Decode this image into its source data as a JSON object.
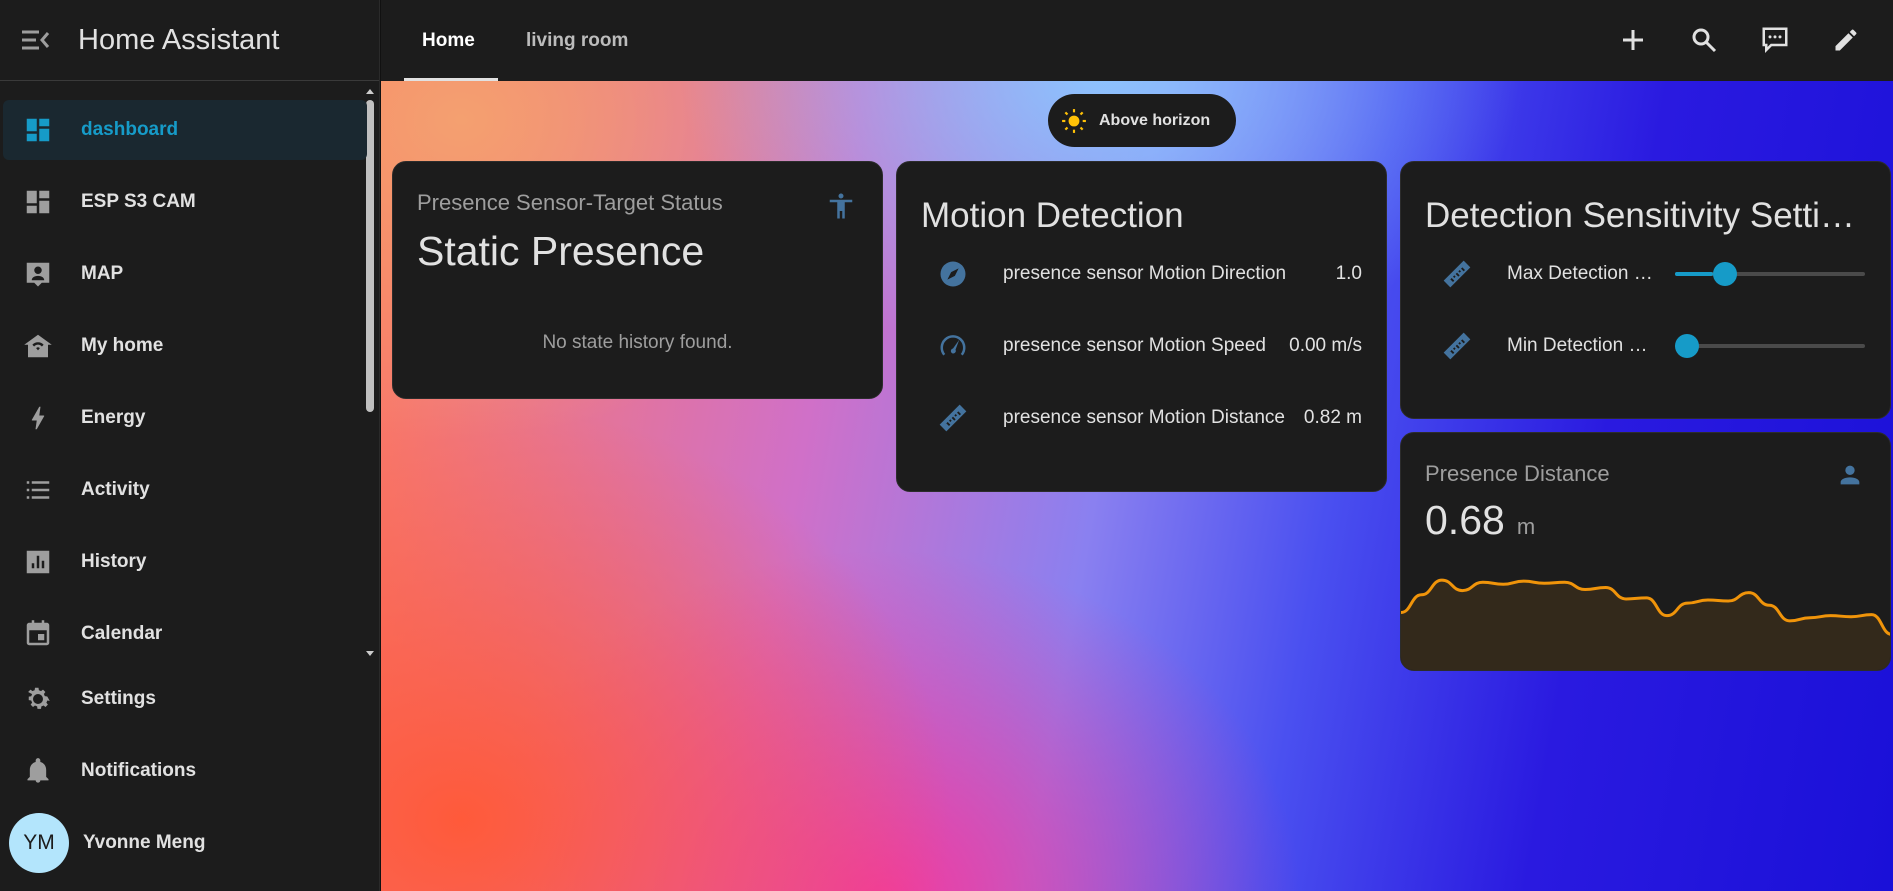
{
  "app": {
    "title": "Home Assistant"
  },
  "sidebar": {
    "items": [
      {
        "label": "dashboard",
        "icon": "view-dashboard-icon",
        "active": true
      },
      {
        "label": "ESP S3 CAM",
        "icon": "view-dashboard-icon"
      },
      {
        "label": "MAP",
        "icon": "account-box-icon"
      },
      {
        "label": "My home",
        "icon": "home-wifi-icon"
      },
      {
        "label": "Energy",
        "icon": "lightning-icon"
      },
      {
        "label": "Activity",
        "icon": "format-list-icon"
      },
      {
        "label": "History",
        "icon": "chart-box-icon"
      },
      {
        "label": "Calendar",
        "icon": "calendar-icon"
      }
    ],
    "settings": "Settings",
    "notifications": "Notifications",
    "user": {
      "initials": "YM",
      "name": "Yvonne Meng"
    }
  },
  "tabs": [
    {
      "label": "Home",
      "active": true
    },
    {
      "label": "living room"
    }
  ],
  "badge": {
    "label": "Above horizon",
    "icon": "sun-icon"
  },
  "cards": {
    "presence": {
      "name": "Presence Sensor-Target Status",
      "state": "Static Presence",
      "empty": "No state history found."
    },
    "motion": {
      "title": "Motion Detection",
      "rows": [
        {
          "name": "presence sensor Motion Direction",
          "value": "1.0",
          "icon": "compass-icon"
        },
        {
          "name": "presence sensor Motion Speed",
          "value": "0.00 m/s",
          "icon": "speedometer-icon"
        },
        {
          "name": "presence sensor Motion Distance",
          "value": "0.82 m",
          "icon": "ruler-icon"
        }
      ]
    },
    "sensitivity": {
      "title": "Detection Sensitivity Settings",
      "rows": [
        {
          "name": "Max Detection Distance",
          "value": 0.2
        },
        {
          "name": "Min Detection Distance",
          "value": 0.0
        }
      ]
    },
    "distance": {
      "name": "Presence Distance",
      "value": "0.68",
      "unit": "m"
    }
  },
  "chart_data": {
    "type": "area",
    "color": "#f0940a",
    "values": [
      0.55,
      0.72,
      0.86,
      0.76,
      0.84,
      0.82,
      0.85,
      0.83,
      0.84,
      0.77,
      0.79,
      0.68,
      0.69,
      0.52,
      0.64,
      0.67,
      0.66,
      0.74,
      0.62,
      0.47,
      0.5,
      0.52,
      0.51,
      0.53,
      0.34
    ]
  }
}
